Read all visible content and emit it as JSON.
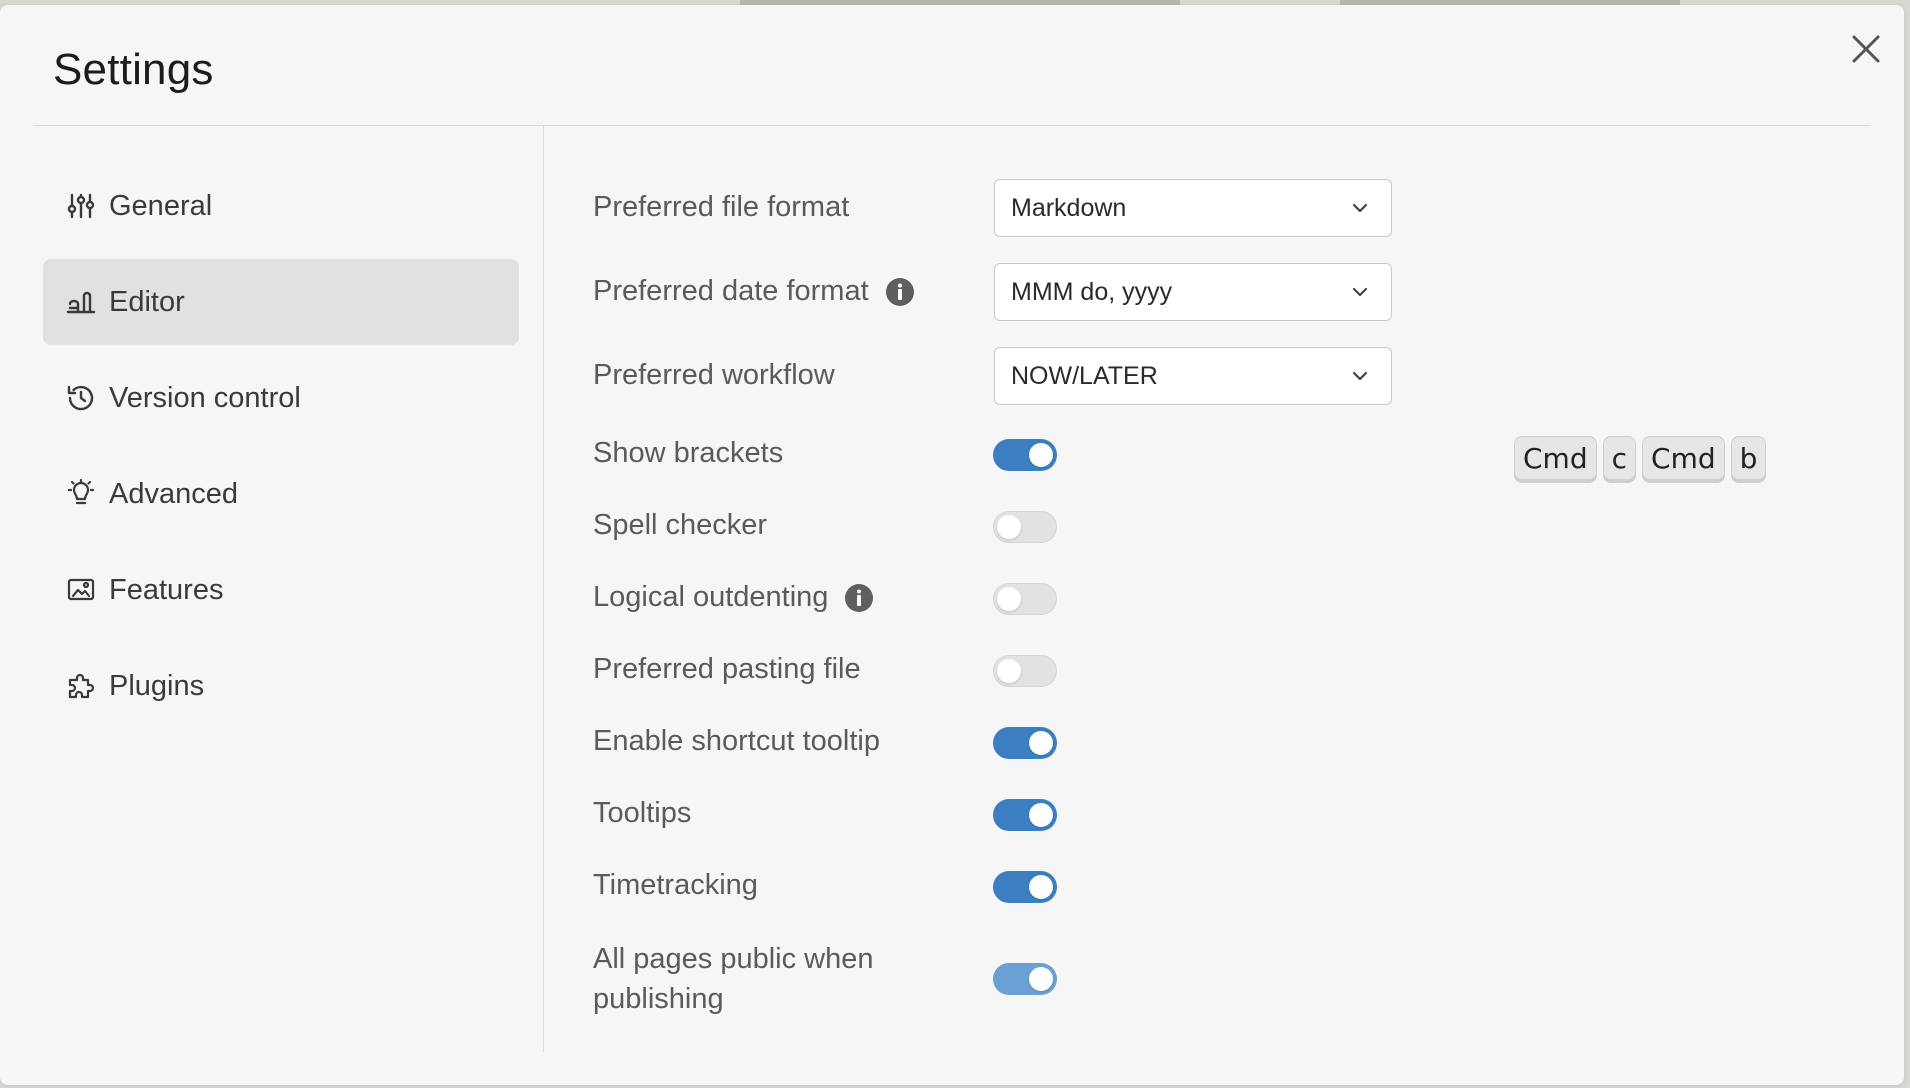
{
  "dialog": {
    "title": "Settings"
  },
  "sidebar": {
    "items": [
      {
        "label": "General",
        "icon": "sliders-icon",
        "active": false
      },
      {
        "label": "Editor",
        "icon": "editor-icon",
        "active": true
      },
      {
        "label": "Version control",
        "icon": "history-icon",
        "active": false
      },
      {
        "label": "Advanced",
        "icon": "lightbulb-icon",
        "active": false
      },
      {
        "label": "Features",
        "icon": "picture-icon",
        "active": false
      },
      {
        "label": "Plugins",
        "icon": "puzzle-icon",
        "active": false
      }
    ]
  },
  "editor": {
    "file_format": {
      "label": "Preferred file format",
      "value": "Markdown"
    },
    "date_format": {
      "label": "Preferred date format",
      "value": "MMM do, yyyy"
    },
    "workflow": {
      "label": "Preferred workflow",
      "value": "NOW/LATER"
    },
    "show_brackets": {
      "label": "Show brackets",
      "on": true,
      "shortcut": [
        "Cmd",
        "c",
        "Cmd",
        "b"
      ]
    },
    "spell_checker": {
      "label": "Spell checker",
      "on": false
    },
    "logical_outdenting": {
      "label": "Logical outdenting",
      "on": false
    },
    "pasting_file": {
      "label": "Preferred pasting file",
      "on": false
    },
    "shortcut_tooltip": {
      "label": "Enable shortcut tooltip",
      "on": true
    },
    "tooltips": {
      "label": "Tooltips",
      "on": true
    },
    "timetracking": {
      "label": "Timetracking",
      "on": true
    },
    "pages_public": {
      "label_line1": "All pages public when",
      "label_line2": "publishing",
      "on": true
    }
  },
  "colors": {
    "toggle_on": "#3b7fc2",
    "toggle_off": "#e2e2e2",
    "active_sidebar": "#e1e1e1"
  }
}
